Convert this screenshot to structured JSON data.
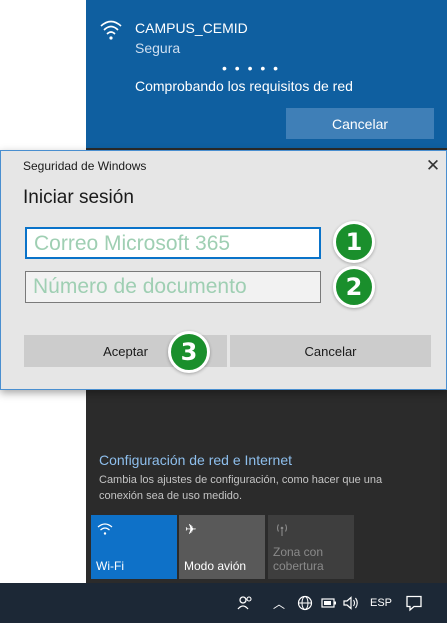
{
  "network": {
    "ssid": "CAMPUS_CEMID",
    "security": "Segura",
    "progress_dots": "• • • • •",
    "status": "Comprobando los requisitos de red",
    "cancel_label": "Cancelar"
  },
  "dialog": {
    "window_title": "Seguridad de Windows",
    "close_glyph": "✕",
    "heading": "Iniciar sesión",
    "email_placeholder": "Correo Microsoft 365",
    "document_placeholder": "Número de documento",
    "accept_label": "Aceptar",
    "cancel_label": "Cancelar"
  },
  "steps": [
    "1",
    "2",
    "3"
  ],
  "settings": {
    "link": "Configuración de red e Internet",
    "description": "Cambia los ajustes de configuración, como hacer que una conexión sea de uso medido."
  },
  "quick_actions": [
    {
      "label": "Wi-Fi",
      "icon": "wifi-icon"
    },
    {
      "label": "Modo avión",
      "icon": "airplane-icon"
    },
    {
      "label": "Zona con cobertura",
      "icon": "mobile-hotspot-icon"
    }
  ],
  "taskbar": {
    "language": "ESP"
  },
  "colors": {
    "accent": "#0e71c8",
    "network_card": "#0f5fa0",
    "step_badge": "#1a8f2c",
    "flyout_bg": "#2b2b2b"
  }
}
